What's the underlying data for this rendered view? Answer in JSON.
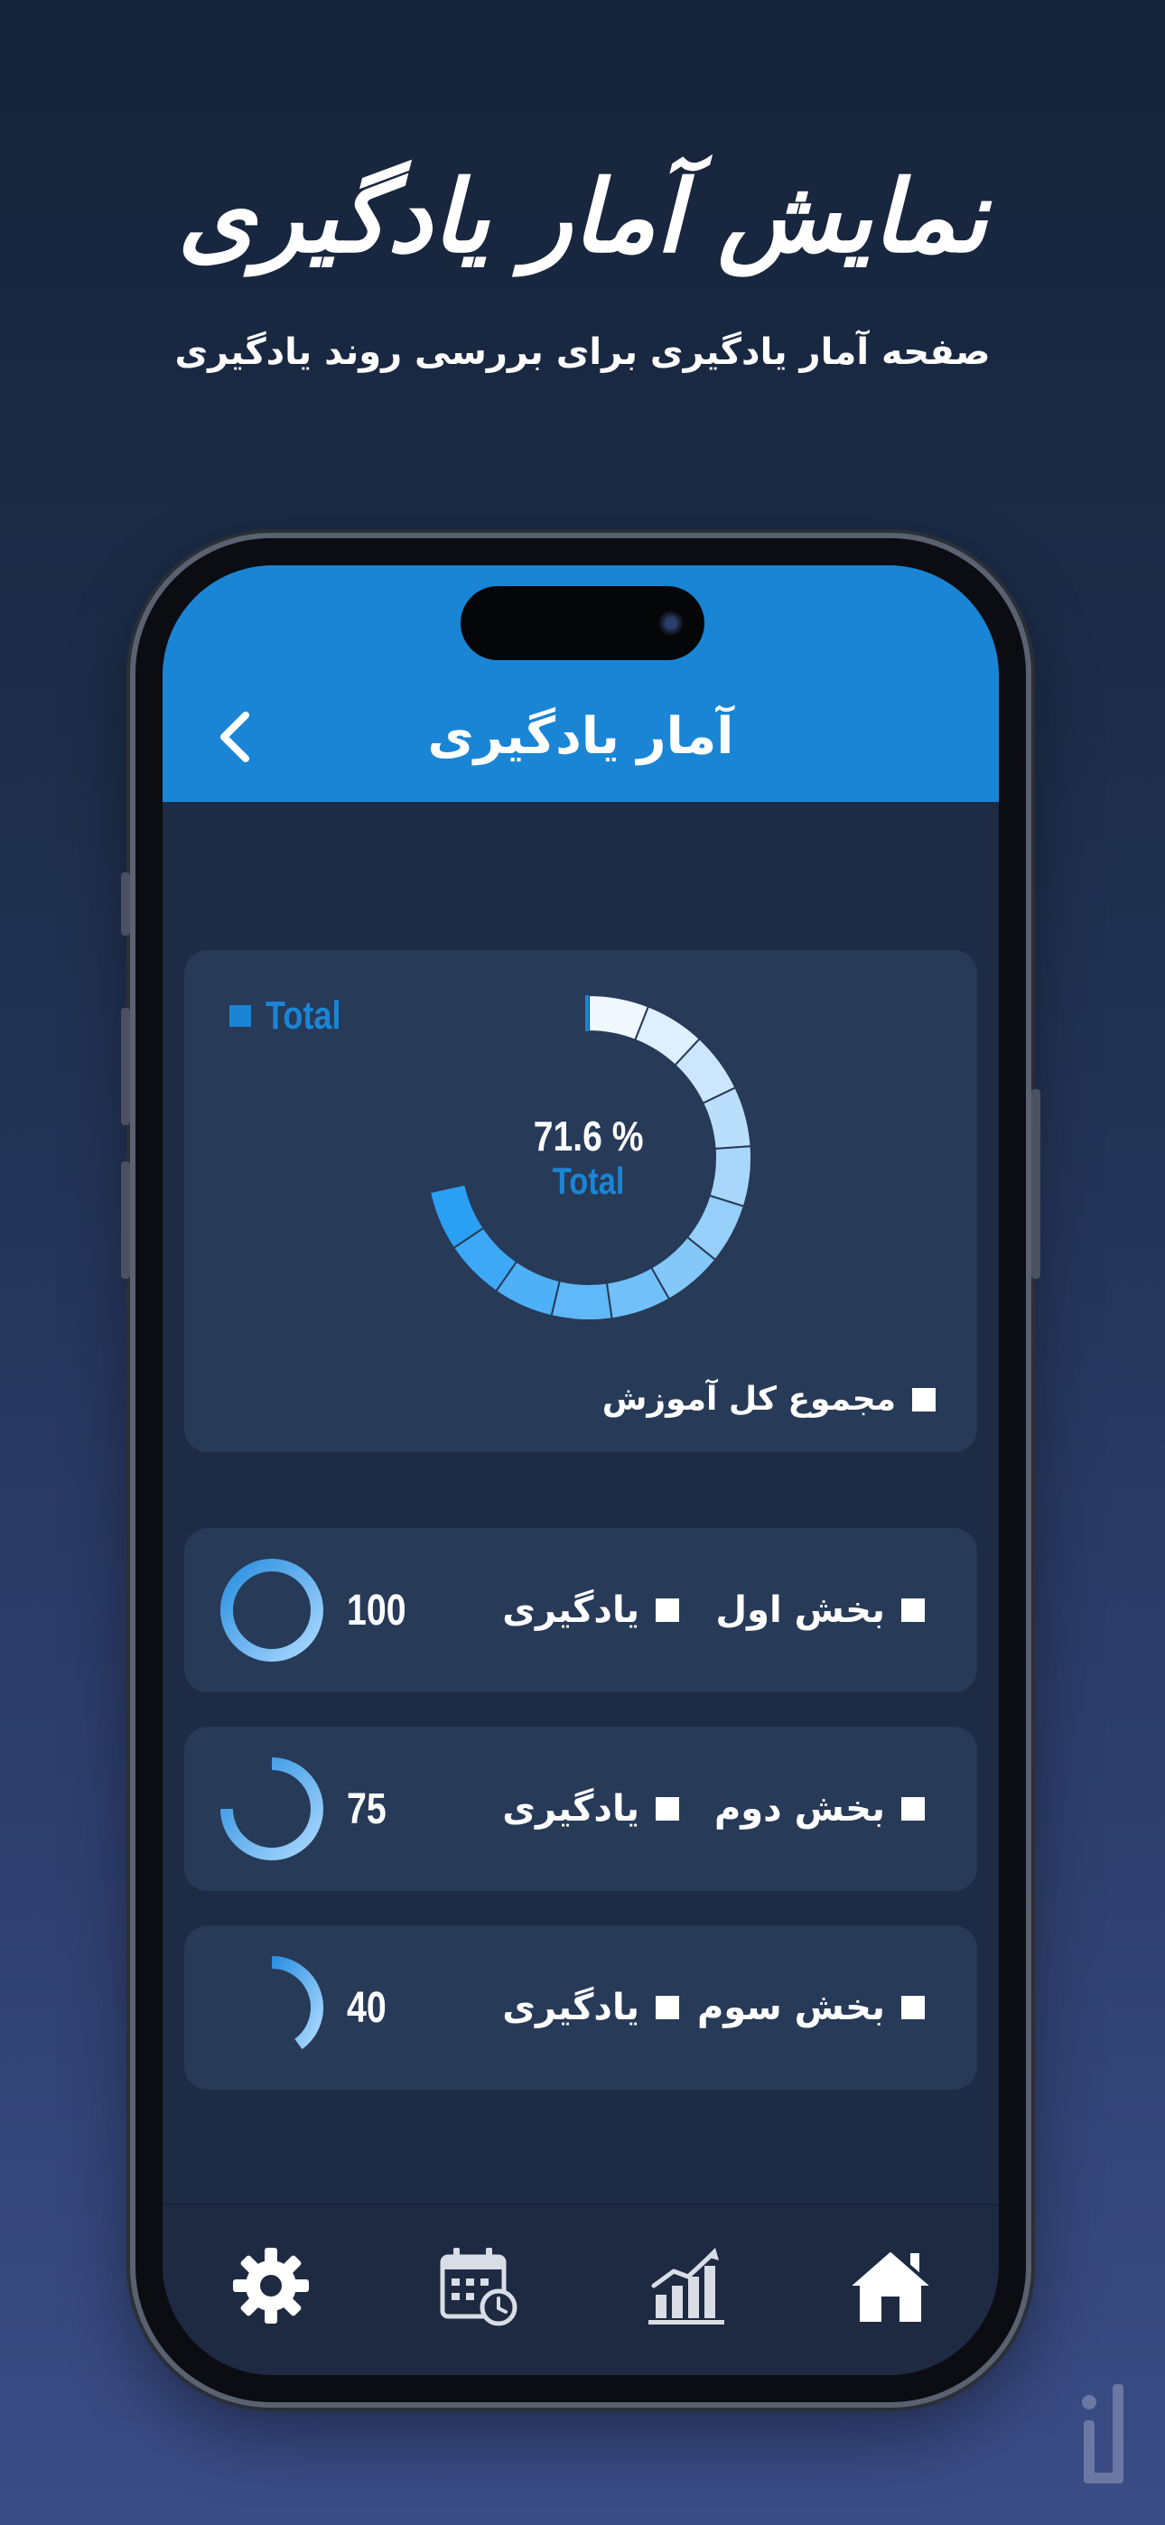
{
  "promo": {
    "title": "نمایش آمار یادگیری",
    "subtitle": "صفحه آمار یادگیری برای بررسی روند یادگیری"
  },
  "header": {
    "title": "آمار یادگیری",
    "back_icon": "chevron-left-icon"
  },
  "total_card": {
    "legend_label": "Total",
    "percent_text": "71.6 %",
    "percent_label": "Total",
    "caption": "مجموع کل آموزش"
  },
  "chart_data": {
    "type": "pie",
    "subtype": "donut",
    "title": "",
    "series": [
      {
        "name": "Total",
        "values": [
          71.6
        ]
      }
    ],
    "percent": 71.6,
    "colors": [
      "#2aa0f5",
      "#e6f3ff"
    ]
  },
  "sections": [
    {
      "label": "بخش اول",
      "learn_label": "یادگیری",
      "value": "100",
      "progress": 1.0
    },
    {
      "label": "بخش دوم",
      "learn_label": "یادگیری",
      "value": "75",
      "progress": 0.75
    },
    {
      "label": "بخش سوم",
      "learn_label": "یادگیری",
      "value": "40",
      "progress": 0.4
    }
  ],
  "bottom_nav": [
    {
      "icon": "home-icon"
    },
    {
      "icon": "bar-chart-icon"
    },
    {
      "icon": "calendar-clock-icon"
    },
    {
      "icon": "gear-icon"
    }
  ],
  "colors": {
    "header_blue": "#1a85d5",
    "background": "#1d2b45",
    "card": "#273a58",
    "accent": "#2aa0f5"
  }
}
